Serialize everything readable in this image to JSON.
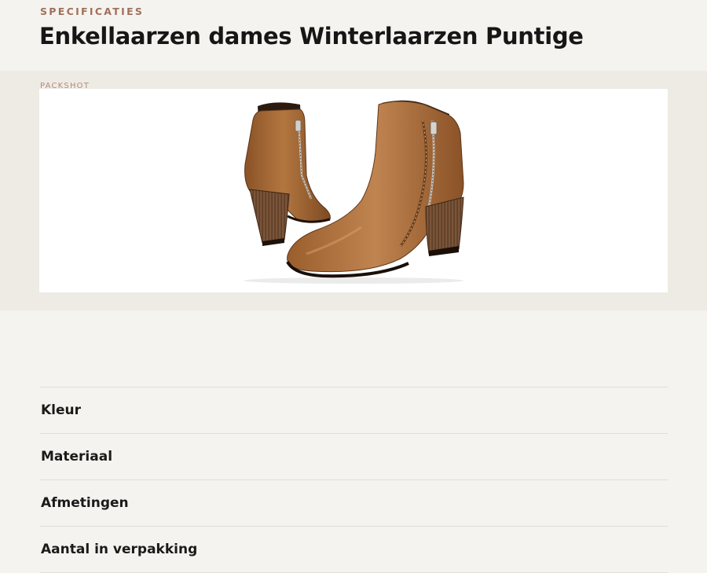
{
  "header": {
    "eyebrow": "SPECIFICATIES",
    "title": "Enkellaarzen dames Winterlaarzen Puntige"
  },
  "packshot": {
    "label": "PACKSHOT",
    "image_icon": "ankle-boots-photo"
  },
  "specs": {
    "rows": [
      {
        "label": "Kleur"
      },
      {
        "label": "Materiaal"
      },
      {
        "label": "Afmetingen"
      },
      {
        "label": "Aantal in verpakking"
      }
    ]
  },
  "colors": {
    "background": "#f5f3ef",
    "band": "#eeebe5",
    "accent": "#a0705a",
    "boot_leather": "#a86a36",
    "boot_heel": "#6e4a30",
    "text": "#1a1a1a",
    "divider": "#e0ddd7"
  }
}
